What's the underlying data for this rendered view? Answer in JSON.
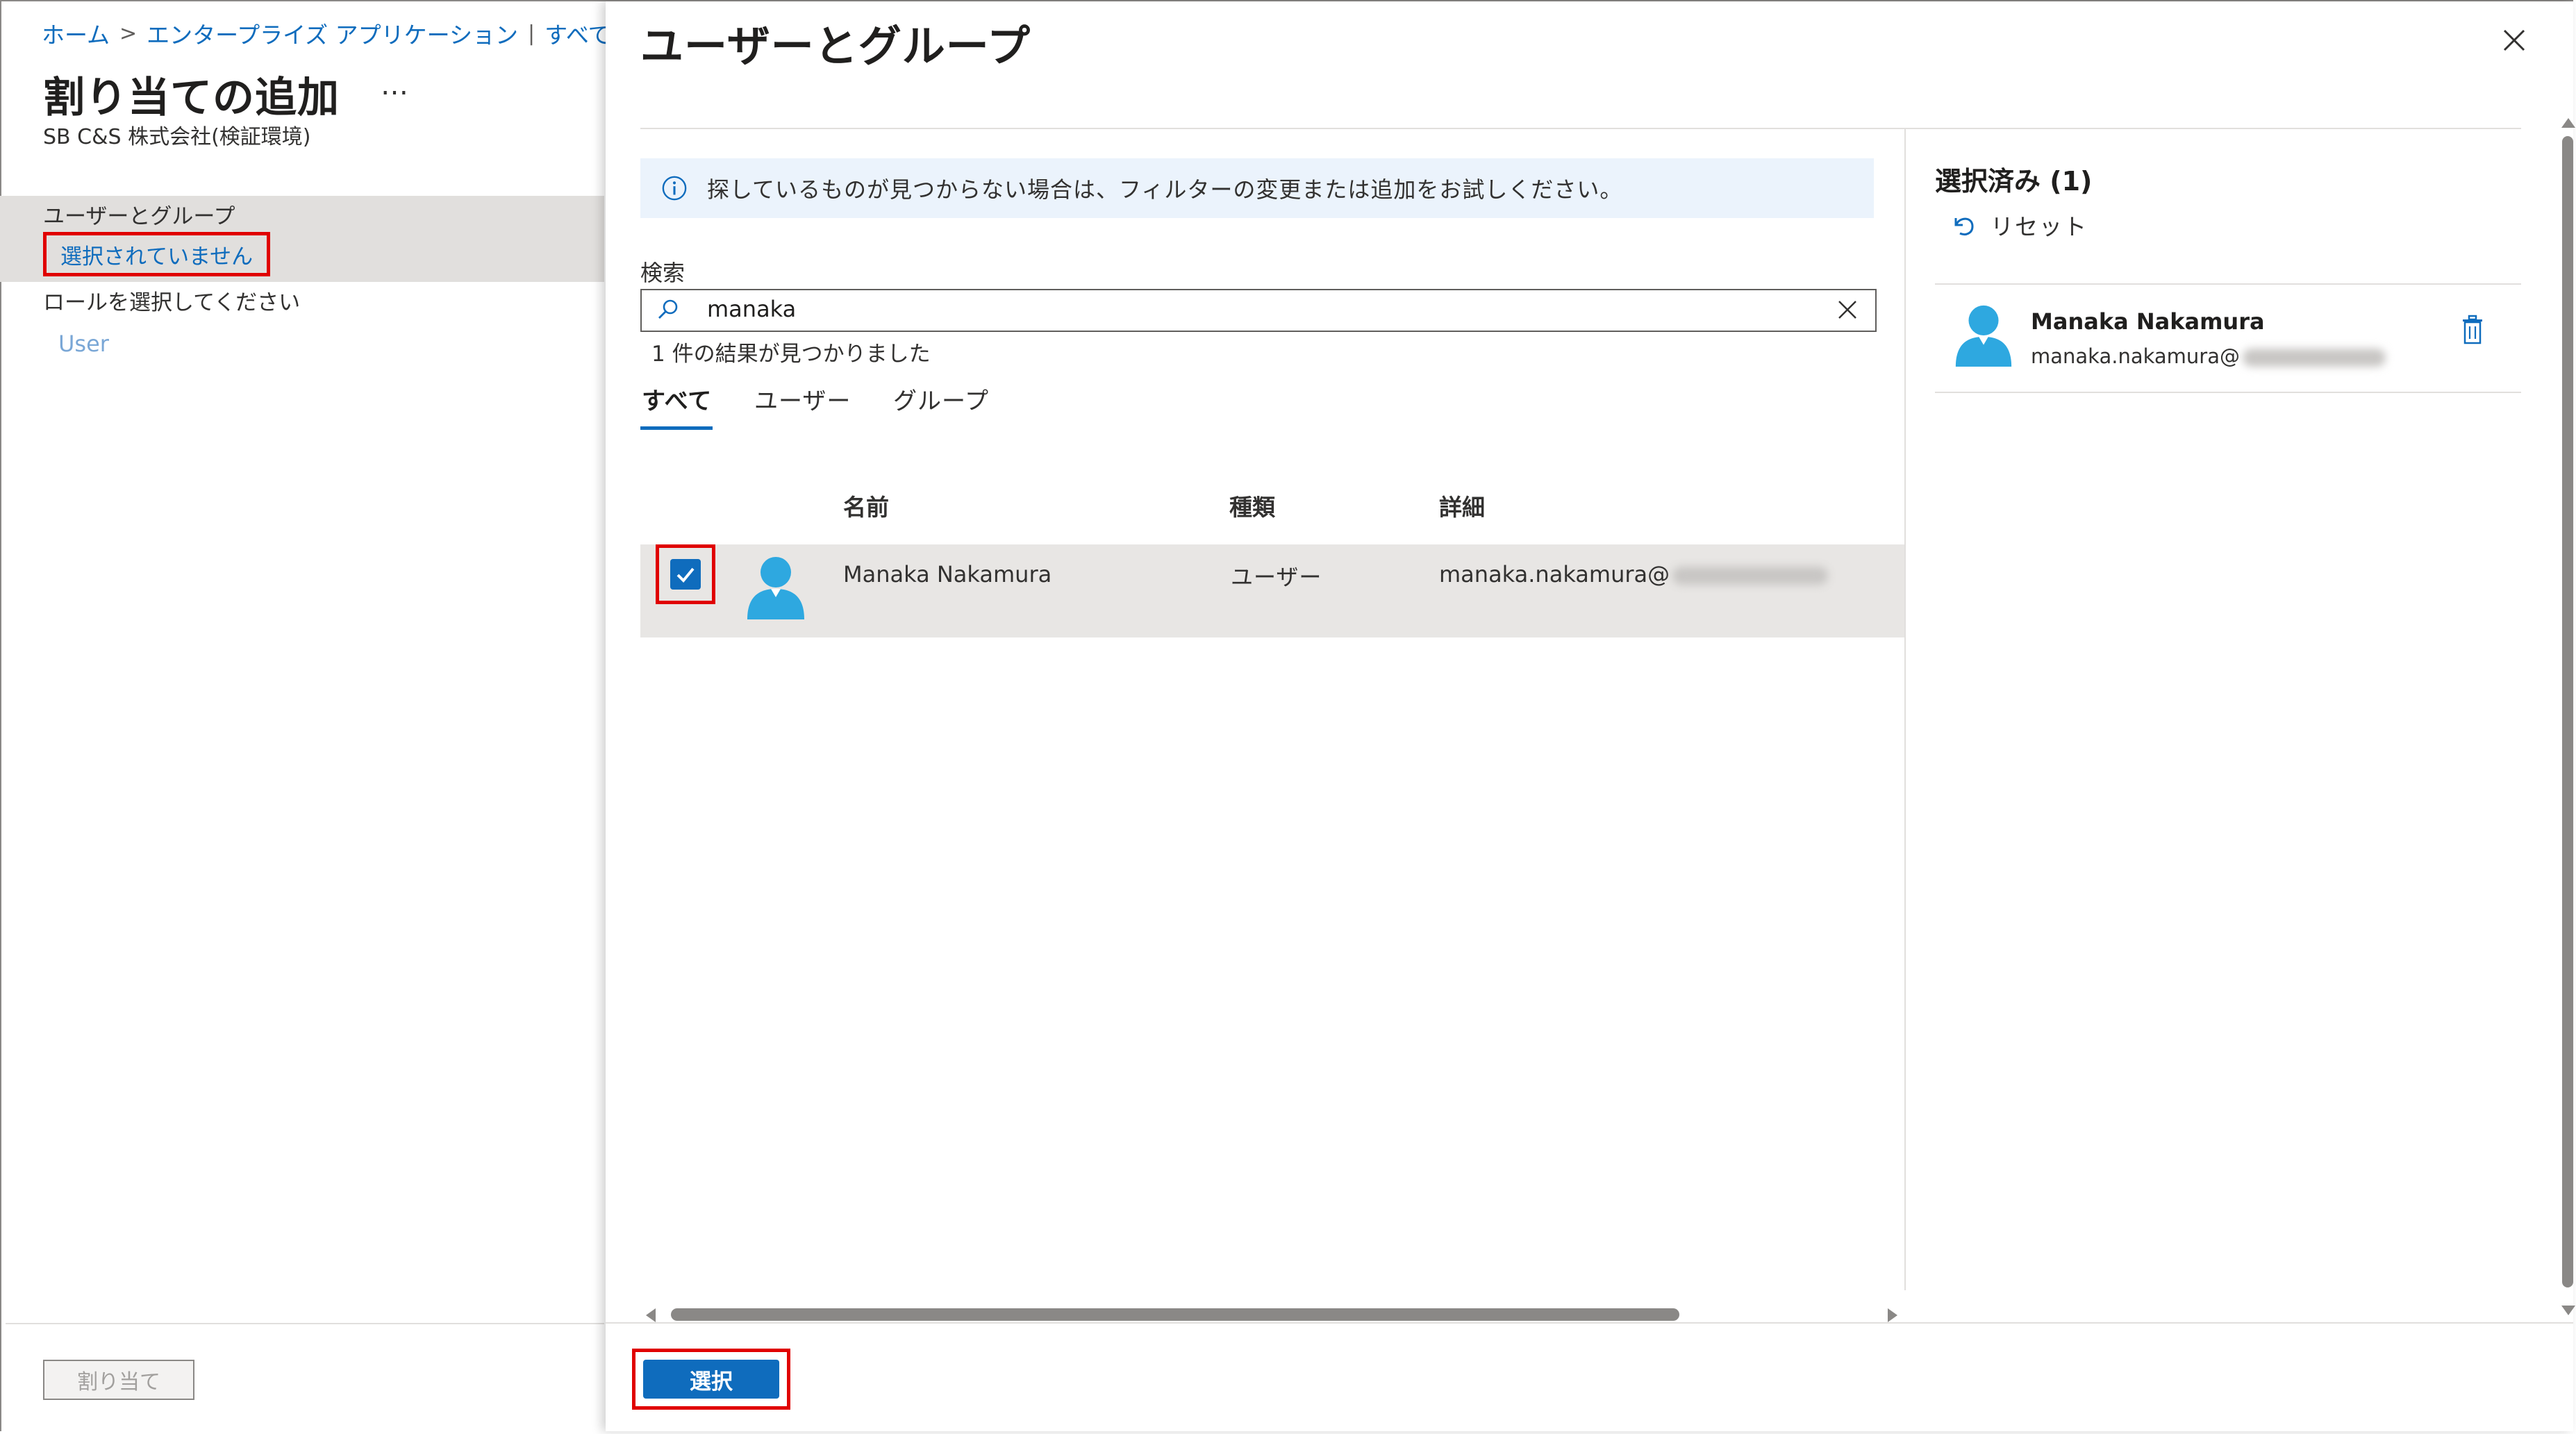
{
  "left_blade": {
    "breadcrumb": [
      "ホーム",
      "エンタープライズ アプリケーション",
      "すべてのアプリケ"
    ],
    "breadcrumb_separator": ">",
    "breadcrumb_separator2": "|",
    "title": "割り当ての追加",
    "more": "…",
    "tenant": "SB C&S 株式会社(検証環境)",
    "users_groups_label": "ユーザーとグループ",
    "users_groups_value": "選択されていません",
    "role_label": "ロールを選択してください",
    "role_value": "User",
    "assign_button": "割り当て"
  },
  "panel": {
    "title": "ユーザーとグループ",
    "info_message": "探しているものが見つからない場合は、フィルターの変更または追加をお試しください。",
    "search_label": "検索",
    "search_value": "manaka",
    "result_count": "1 件の結果が見つかりました",
    "tabs": [
      "すべて",
      "ユーザー",
      "グループ"
    ],
    "active_tab": "すべて",
    "columns": [
      "名前",
      "種類",
      "詳細"
    ],
    "rows": [
      {
        "name": "Manaka Nakamura",
        "type": "ユーザー",
        "detail": "manaka.nakamura@",
        "checked": true
      }
    ],
    "select_button": "選択"
  },
  "selected": {
    "heading": "選択済み (1)",
    "reset": "リセット",
    "items": [
      {
        "name": "Manaka Nakamura",
        "email": "manaka.nakamura@"
      }
    ]
  },
  "colors": {
    "accent": "#0f6cbd",
    "highlight": "#e00000",
    "row_selected": "#e8e6e4",
    "info_bg": "#ebf3fc",
    "avatar": "#2ea8e0"
  },
  "icons": {
    "close": "close-icon",
    "info": "info-icon",
    "search": "search-icon",
    "clear": "clear-icon",
    "check": "checkmark-icon",
    "user": "user-avatar-icon",
    "reset": "undo-icon",
    "delete": "trash-icon"
  }
}
